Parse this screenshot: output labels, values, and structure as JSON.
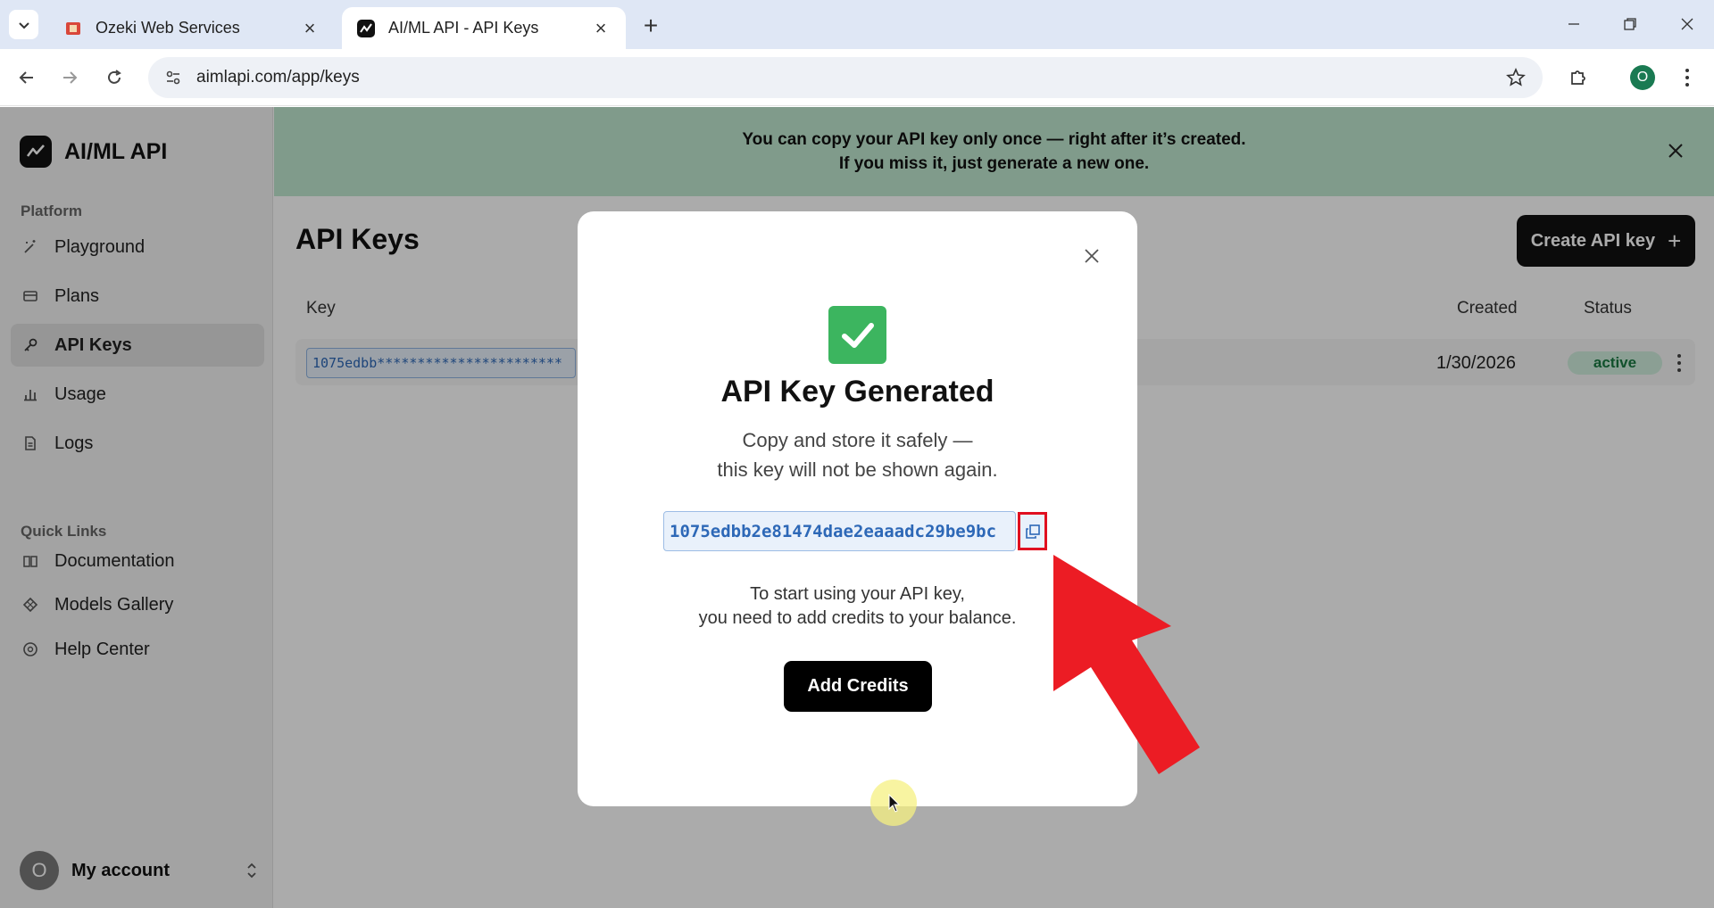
{
  "browser": {
    "tabs": [
      {
        "title": "Ozeki Web Services",
        "active": false
      },
      {
        "title": "AI/ML API - API Keys",
        "active": true
      }
    ],
    "url": "aimlapi.com/app/keys",
    "profile_initial": "O"
  },
  "sidebar": {
    "brand": "AI/ML API",
    "platform_label": "Platform",
    "platform_items": [
      {
        "label": "Playground",
        "icon": "wand-icon"
      },
      {
        "label": "Plans",
        "icon": "card-icon"
      },
      {
        "label": "API Keys",
        "icon": "key-icon",
        "selected": true
      },
      {
        "label": "Usage",
        "icon": "bar-chart-icon"
      },
      {
        "label": "Logs",
        "icon": "document-icon"
      }
    ],
    "quick_links_label": "Quick Links",
    "quick_links": [
      {
        "label": "Documentation",
        "icon": "book-icon"
      },
      {
        "label": "Models Gallery",
        "icon": "diamond-icon"
      },
      {
        "label": "Help Center",
        "icon": "help-icon"
      }
    ],
    "account": {
      "initial": "O",
      "label": "My account"
    }
  },
  "banner": {
    "line1": "You can copy your API key only once — right after it’s created.",
    "line2": "If you miss it, just generate a new one."
  },
  "page": {
    "title": "API Keys",
    "create_label": "Create API key",
    "table": {
      "headers": {
        "key": "Key",
        "created": "Created",
        "status": "Status"
      },
      "rows": [
        {
          "key": "1075edbb***********************",
          "created": "1/30/2026",
          "status": "active"
        }
      ]
    }
  },
  "modal": {
    "title": "API Key Generated",
    "subtitle_line1": "Copy and store it safely —",
    "subtitle_line2": "this key will not be shown again.",
    "api_key": "1075edbb2e81474dae2eaaadc29be9bc",
    "info_line1": "To start using your API key,",
    "info_line2": "you need to add credits to your balance.",
    "add_credits_label": "Add Credits"
  },
  "colors": {
    "banner_bg": "#bfe7cf",
    "success": "#3cb55f",
    "highlight_red": "#e01020",
    "key_blue": "#2d68b7"
  }
}
